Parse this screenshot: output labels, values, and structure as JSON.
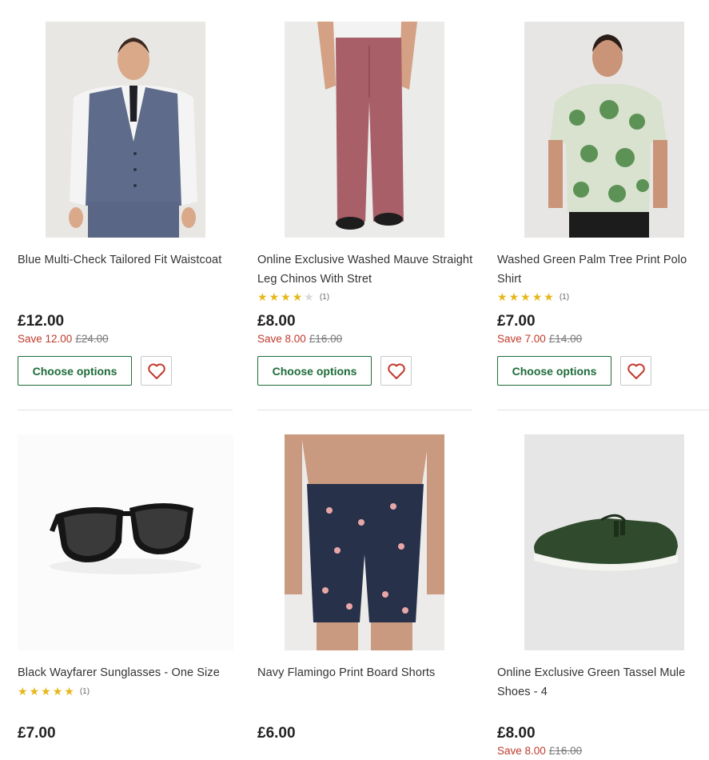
{
  "products": [
    {
      "title": "Blue Multi-Check Tailored Fit Waistcoat",
      "price": "£12.00",
      "save": "Save 12.00",
      "was": "£24.00",
      "rating_count": "",
      "choose_label": "Choose options"
    },
    {
      "title": "Online Exclusive Washed Mauve Straight Leg Chinos With Stret",
      "price": "£8.00",
      "save": "Save 8.00",
      "was": "£16.00",
      "rating": 4,
      "rating_count": "(1)",
      "choose_label": "Choose options"
    },
    {
      "title": "Washed Green Palm Tree Print Polo Shirt",
      "price": "£7.00",
      "save": "Save 7.00",
      "was": "£14.00",
      "rating": 5,
      "rating_count": "(1)",
      "choose_label": "Choose options"
    },
    {
      "title": "Black Wayfarer Sunglasses - One Size",
      "price": "£7.00",
      "rating": 5,
      "rating_count": "(1)"
    },
    {
      "title": "Navy Flamingo Print Board Shorts",
      "price": "£6.00"
    },
    {
      "title": "Online Exclusive Green Tassel Mule Shoes - 4",
      "price": "£8.00",
      "save": "Save 8.00",
      "was": "£16.00"
    }
  ],
  "colors": {
    "accent_green": "#1e6b3a",
    "save_red": "#c0392b",
    "star_gold": "#e7b71a",
    "heart_red": "#c0392b"
  },
  "icons": {
    "wishlist": "heart-icon",
    "rating": "star-icon"
  }
}
